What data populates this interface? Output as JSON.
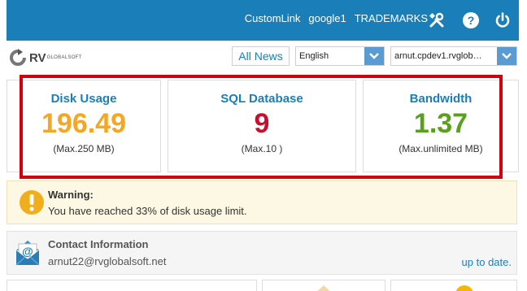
{
  "header": {
    "links": [
      "CustomLink",
      "google1",
      "TRADEMARKS"
    ],
    "icons": [
      "tools-icon",
      "help-icon",
      "power-icon"
    ]
  },
  "logo": {
    "text": "RV",
    "sub": "GLOBALSOFT"
  },
  "toolbar": {
    "all_news": "All News",
    "language": "English",
    "server": "arnut.cpdev1.rvglob…"
  },
  "stats": [
    {
      "title": "Disk Usage",
      "value": "196.49",
      "sub": "(Max.250 MB)",
      "color": "#f5a623"
    },
    {
      "title": "SQL Database",
      "value": "9",
      "sub": "(Max.10 )",
      "color": "#c8102e"
    },
    {
      "title": "Bandwidth",
      "value": "1.37",
      "sub": "(Max.unlimited MB)",
      "color": "#5aa01e"
    }
  ],
  "warning": {
    "title": "Warning:",
    "text": "You have reached 33% of disk usage limit."
  },
  "contact": {
    "title": "Contact Information",
    "email": "arnut22@rvglobalsoft.net",
    "status": "up to date."
  },
  "colors": {
    "brand": "#1a7fb8",
    "highlight": "#d0000c"
  }
}
